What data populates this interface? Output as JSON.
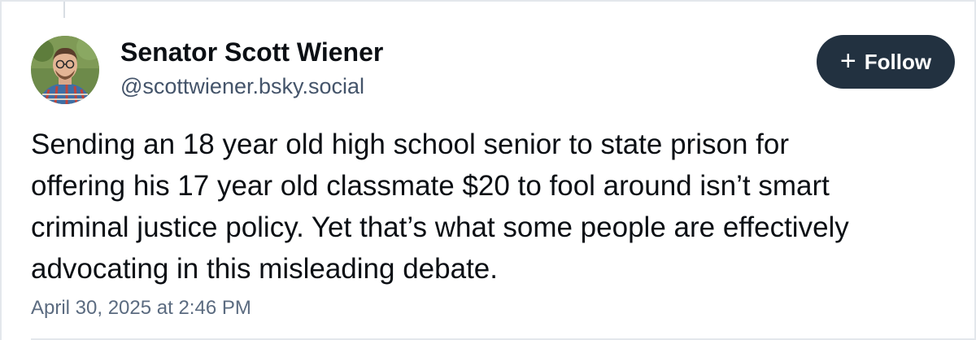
{
  "author": {
    "display_name": "Senator Scott Wiener",
    "handle": "@scottwiener.bsky.social"
  },
  "follow_button": {
    "icon": "plus-icon",
    "label": "Follow",
    "background": "#223140"
  },
  "post": {
    "text_lines": [
      "Sending an 18 year old high school senior to state prison for",
      "offering his 17 year old classmate $20 to fool around isn’t smart",
      "criminal justice policy. Yet that’s what some people are effectively",
      "advocating in this misleading debate."
    ],
    "timestamp": "April 30, 2025 at 2:46 PM"
  }
}
